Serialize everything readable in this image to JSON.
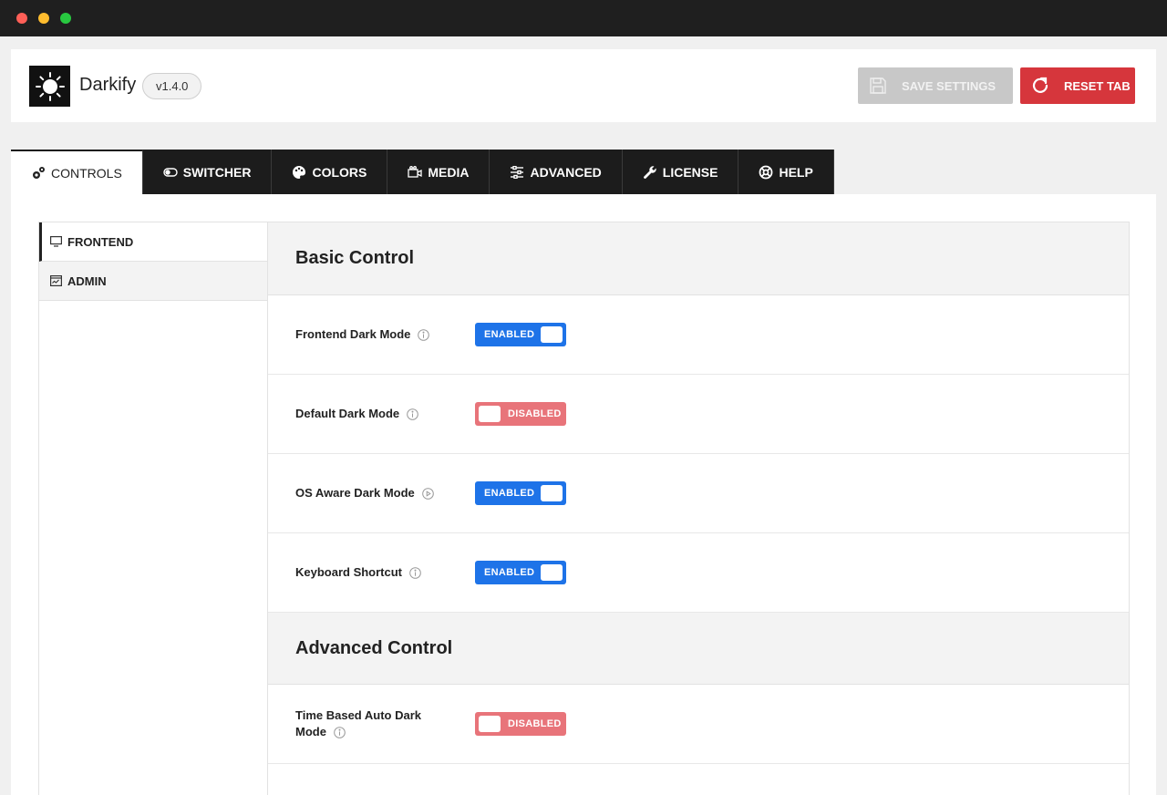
{
  "app": {
    "title": "Darkify",
    "version": "v1.4.0"
  },
  "toolbar": {
    "save_label": "SAVE SETTINGS",
    "reset_label": "RESET TAB"
  },
  "tabs": [
    {
      "label": "CONTROLS",
      "icon": "gears-icon",
      "active": true
    },
    {
      "label": "SWITCHER",
      "icon": "toggle-icon"
    },
    {
      "label": "COLORS",
      "icon": "palette-icon"
    },
    {
      "label": "MEDIA",
      "icon": "media-icon"
    },
    {
      "label": "ADVANCED",
      "icon": "sliders-icon"
    },
    {
      "label": "LICENSE",
      "icon": "wrench-icon"
    },
    {
      "label": "HELP",
      "icon": "lifebuoy-icon"
    }
  ],
  "subnav": [
    {
      "label": "FRONTEND",
      "icon": "monitor-icon",
      "active": true
    },
    {
      "label": "ADMIN",
      "icon": "dashboard-icon"
    }
  ],
  "sections": {
    "basic": {
      "title": "Basic Control",
      "rows": [
        {
          "label": "Frontend Dark Mode",
          "state": "ENABLED"
        },
        {
          "label": "Default Dark Mode",
          "state": "DISABLED"
        },
        {
          "label": "OS Aware Dark Mode",
          "state": "ENABLED"
        },
        {
          "label": "Keyboard Shortcut",
          "state": "ENABLED"
        }
      ]
    },
    "advanced": {
      "title": "Advanced Control",
      "rows": [
        {
          "label": "Time Based Auto Dark Mode",
          "state": "DISABLED"
        }
      ]
    }
  },
  "colors": {
    "enabled": "#1e73e8",
    "disabled": "#e8747a",
    "reset": "#d6363c",
    "tab_bar": "#1c1c1c"
  }
}
